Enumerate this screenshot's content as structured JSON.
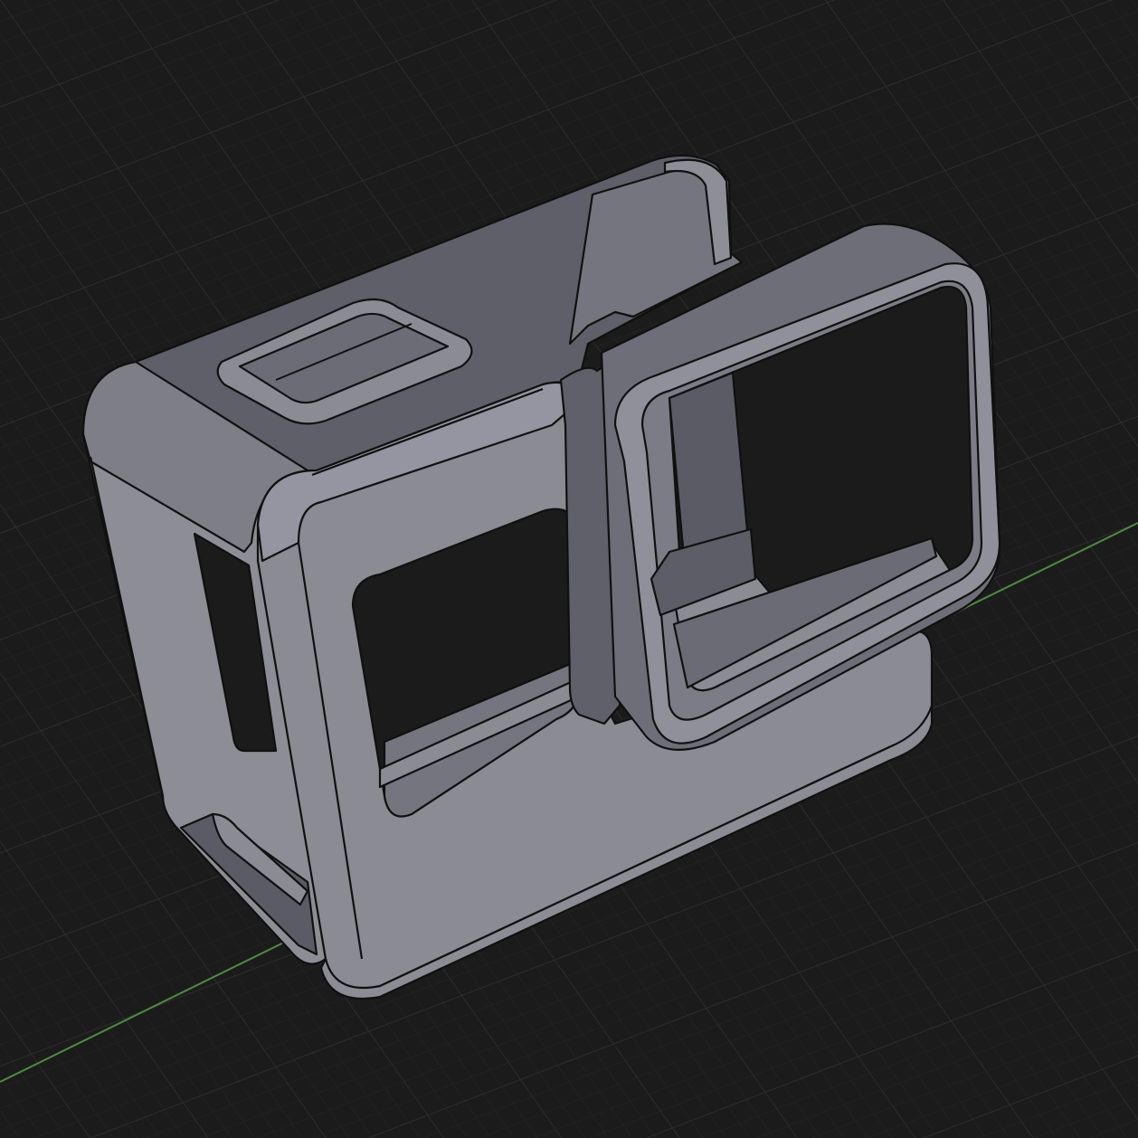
{
  "viewport": {
    "background": "#1b1b1b",
    "grid_minor_color": "#262626",
    "grid_major_color": "#303030",
    "axis_color": "#4f8a45"
  },
  "model": {
    "name": "camera-frame-mount",
    "face_light": "#8b8c94",
    "face_mid": "#7c7d85",
    "face_dark": "#60616a",
    "face_shadow": "#4c4d55",
    "edge_color": "#101010"
  }
}
